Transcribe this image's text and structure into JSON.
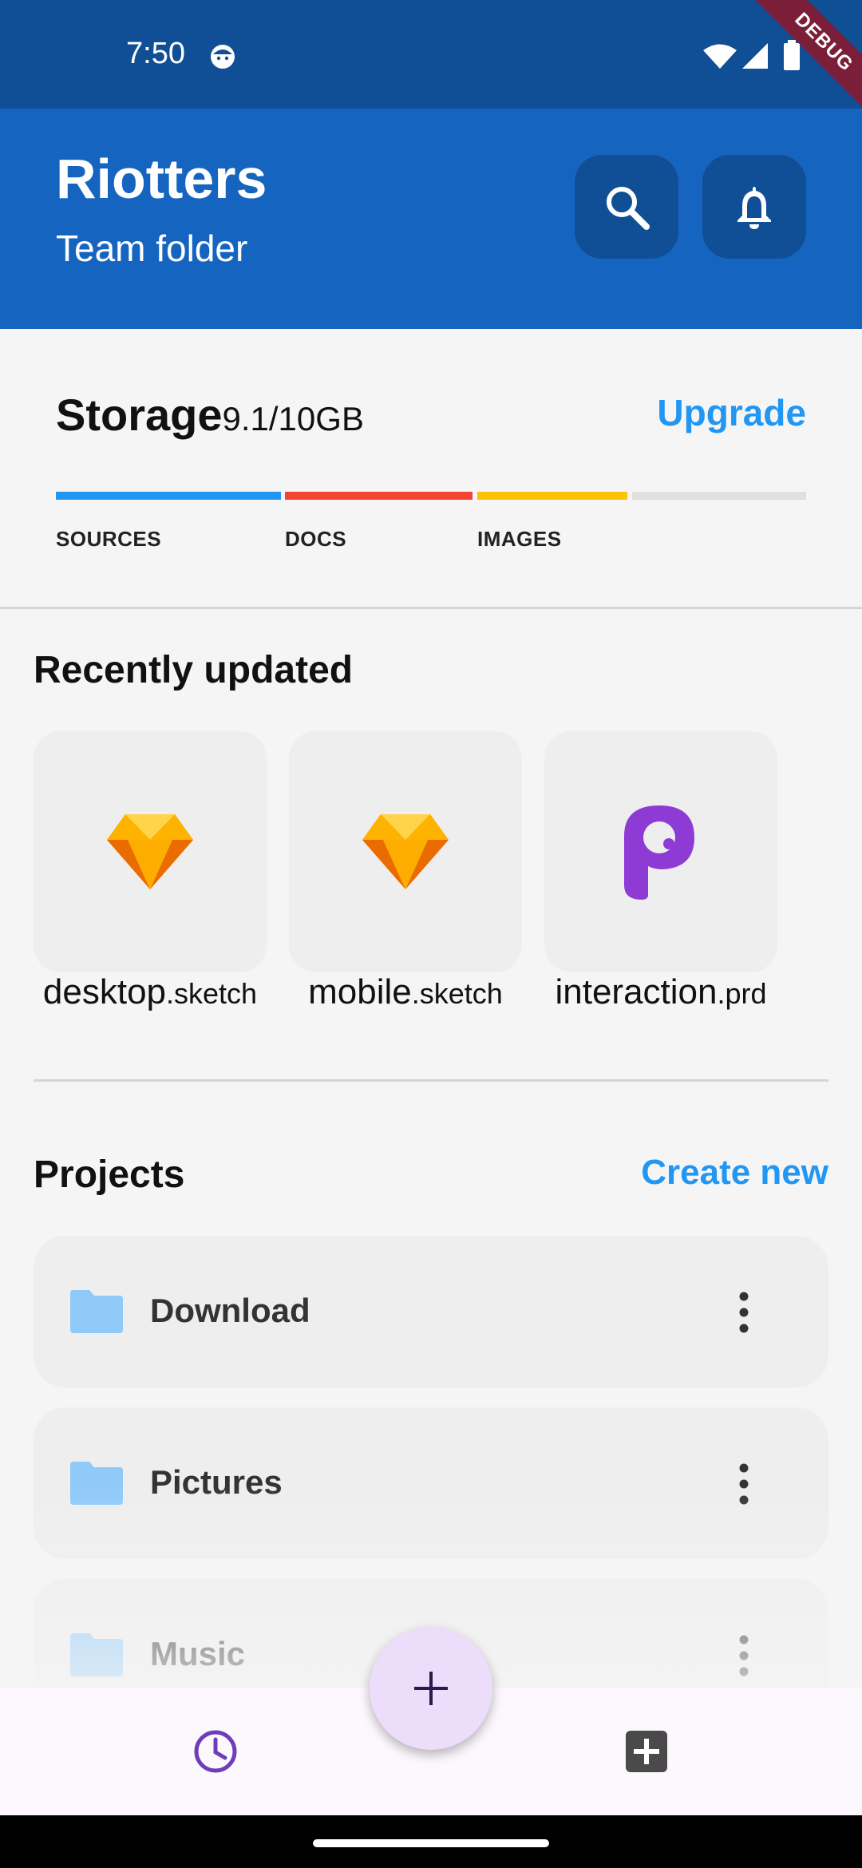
{
  "status_bar": {
    "time": "7:50",
    "debug_label": "DEBUG"
  },
  "app_bar": {
    "title": "Riotters",
    "subtitle": "Team folder"
  },
  "storage": {
    "title": "Storage",
    "amount": "9.1/10GB",
    "upgrade_label": "Upgrade",
    "segments": [
      {
        "label": "SOURCES",
        "color": "#2196F3"
      },
      {
        "label": "DOCS",
        "color": "#F44336"
      },
      {
        "label": "IMAGES",
        "color": "#FFC107"
      },
      {
        "label": "",
        "color": "#E0E0E0"
      }
    ]
  },
  "recent": {
    "title": "Recently updated",
    "items": [
      {
        "name": "desktop",
        "ext": ".sketch",
        "icon": "sketch-icon"
      },
      {
        "name": "mobile",
        "ext": ".sketch",
        "icon": "sketch-icon"
      },
      {
        "name": "interaction",
        "ext": ".prd",
        "icon": "protopie-icon"
      }
    ]
  },
  "projects": {
    "title": "Projects",
    "create_label": "Create new",
    "items": [
      {
        "name": "Download",
        "icon": "folder-icon"
      },
      {
        "name": "Pictures",
        "icon": "folder-icon"
      },
      {
        "name": "Music",
        "icon": "folder-icon"
      }
    ]
  },
  "bottom_nav": {
    "items": [
      "clock-icon",
      "add-box-icon"
    ],
    "fab_icon": "plus-icon"
  },
  "colors": {
    "primary": "#1565C0",
    "primary_dark": "#104F95",
    "link": "#2196F3",
    "nav_accent": "#6A3FB8",
    "fab_bg": "#ECDDFB",
    "folder": "#90CAF9"
  }
}
